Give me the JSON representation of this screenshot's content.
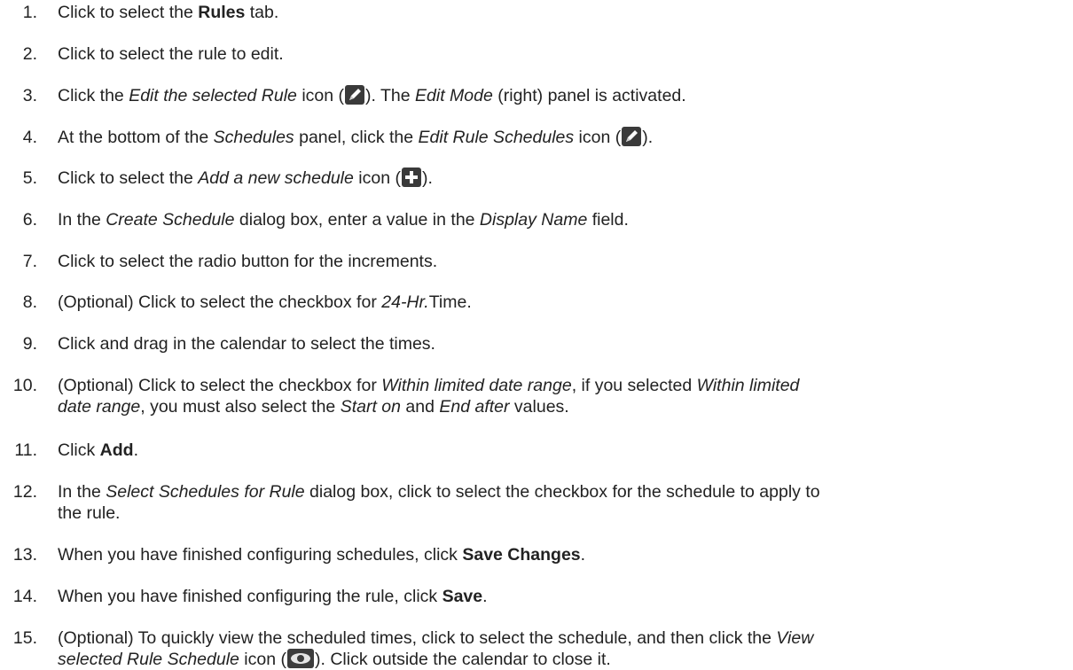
{
  "steps": [
    {
      "num": "1.",
      "parts": [
        {
          "t": "Click to select the "
        },
        {
          "t": "Rules",
          "s": "b"
        },
        {
          "t": " tab."
        }
      ]
    },
    {
      "num": "2.",
      "parts": [
        {
          "t": "Click to select the rule to edit."
        }
      ]
    },
    {
      "num": "3.",
      "parts": [
        {
          "t": "Click the "
        },
        {
          "t": "Edit the selected Rule",
          "s": "i"
        },
        {
          "t": " icon ("
        },
        {
          "icon": "pencil-icon"
        },
        {
          "t": "). The "
        },
        {
          "t": "Edit Mode",
          "s": "i"
        },
        {
          "t": " (right) panel is activated."
        }
      ]
    },
    {
      "num": "4.",
      "parts": [
        {
          "t": "At the bottom of the "
        },
        {
          "t": "Schedules",
          "s": "i"
        },
        {
          "t": " panel, click the "
        },
        {
          "t": "Edit Rule Schedules",
          "s": "i"
        },
        {
          "t": " icon ("
        },
        {
          "icon": "pencil-icon"
        },
        {
          "t": ")."
        }
      ]
    },
    {
      "num": "5.",
      "parts": [
        {
          "t": "Click to select the "
        },
        {
          "t": "Add a new schedule",
          "s": "i"
        },
        {
          "t": " icon ("
        },
        {
          "icon": "plus-icon"
        },
        {
          "t": ")."
        }
      ]
    },
    {
      "num": "6.",
      "parts": [
        {
          "t": "In the "
        },
        {
          "t": "Create Schedule",
          "s": "i"
        },
        {
          "t": " dialog box, enter a value in the "
        },
        {
          "t": "Display Name",
          "s": "i"
        },
        {
          "t": " field."
        }
      ]
    },
    {
      "num": "7.",
      "parts": [
        {
          "t": "Click to select the radio button for the increments."
        }
      ]
    },
    {
      "num": "8.",
      "parts": [
        {
          "t": "(Optional) Click to select the checkbox for "
        },
        {
          "t": "24-Hr.",
          "s": "i"
        },
        {
          "t": "Time."
        }
      ]
    },
    {
      "num": "9.",
      "parts": [
        {
          "t": "Click and drag in the calendar to select the times."
        }
      ]
    },
    {
      "num": "10.",
      "lines": [
        [
          {
            "t": "(Optional) Click to select the checkbox for "
          },
          {
            "t": "Within limited date range",
            "s": "i"
          },
          {
            "t": ", if you selected "
          },
          {
            "t": "Within limited",
            "s": "i"
          }
        ],
        [
          {
            "t": "date range",
            "s": "i"
          },
          {
            "t": ", you must also select the "
          },
          {
            "t": "Start on",
            "s": "i"
          },
          {
            "t": " and "
          },
          {
            "t": "End after",
            "s": "i"
          },
          {
            "t": " values."
          }
        ]
      ]
    },
    {
      "num": "11.",
      "parts": [
        {
          "t": "Click "
        },
        {
          "t": "Add",
          "s": "b"
        },
        {
          "t": "."
        }
      ]
    },
    {
      "num": "12.",
      "lines": [
        [
          {
            "t": "In the "
          },
          {
            "t": "Select Schedules for Rule",
            "s": "i"
          },
          {
            "t": " dialog box, click to select the checkbox for the schedule to apply to"
          }
        ],
        [
          {
            "t": "the rule."
          }
        ]
      ]
    },
    {
      "num": "13.",
      "parts": [
        {
          "t": "When you have finished configuring schedules, click "
        },
        {
          "t": "Save Changes",
          "s": "b"
        },
        {
          "t": "."
        }
      ]
    },
    {
      "num": "14.",
      "parts": [
        {
          "t": "When you have finished configuring the rule, click "
        },
        {
          "t": "Save",
          "s": "b"
        },
        {
          "t": "."
        }
      ]
    },
    {
      "num": "15.",
      "lines": [
        [
          {
            "t": "(Optional) To quickly view the scheduled times, click to select the schedule, and then click the "
          },
          {
            "t": "View",
            "s": "i"
          }
        ],
        [
          {
            "t": "selected Rule Schedule",
            "s": "i"
          },
          {
            "t": " icon ("
          },
          {
            "icon": "eye-icon"
          },
          {
            "t": "). Click outside the calendar to close it."
          }
        ]
      ]
    }
  ]
}
